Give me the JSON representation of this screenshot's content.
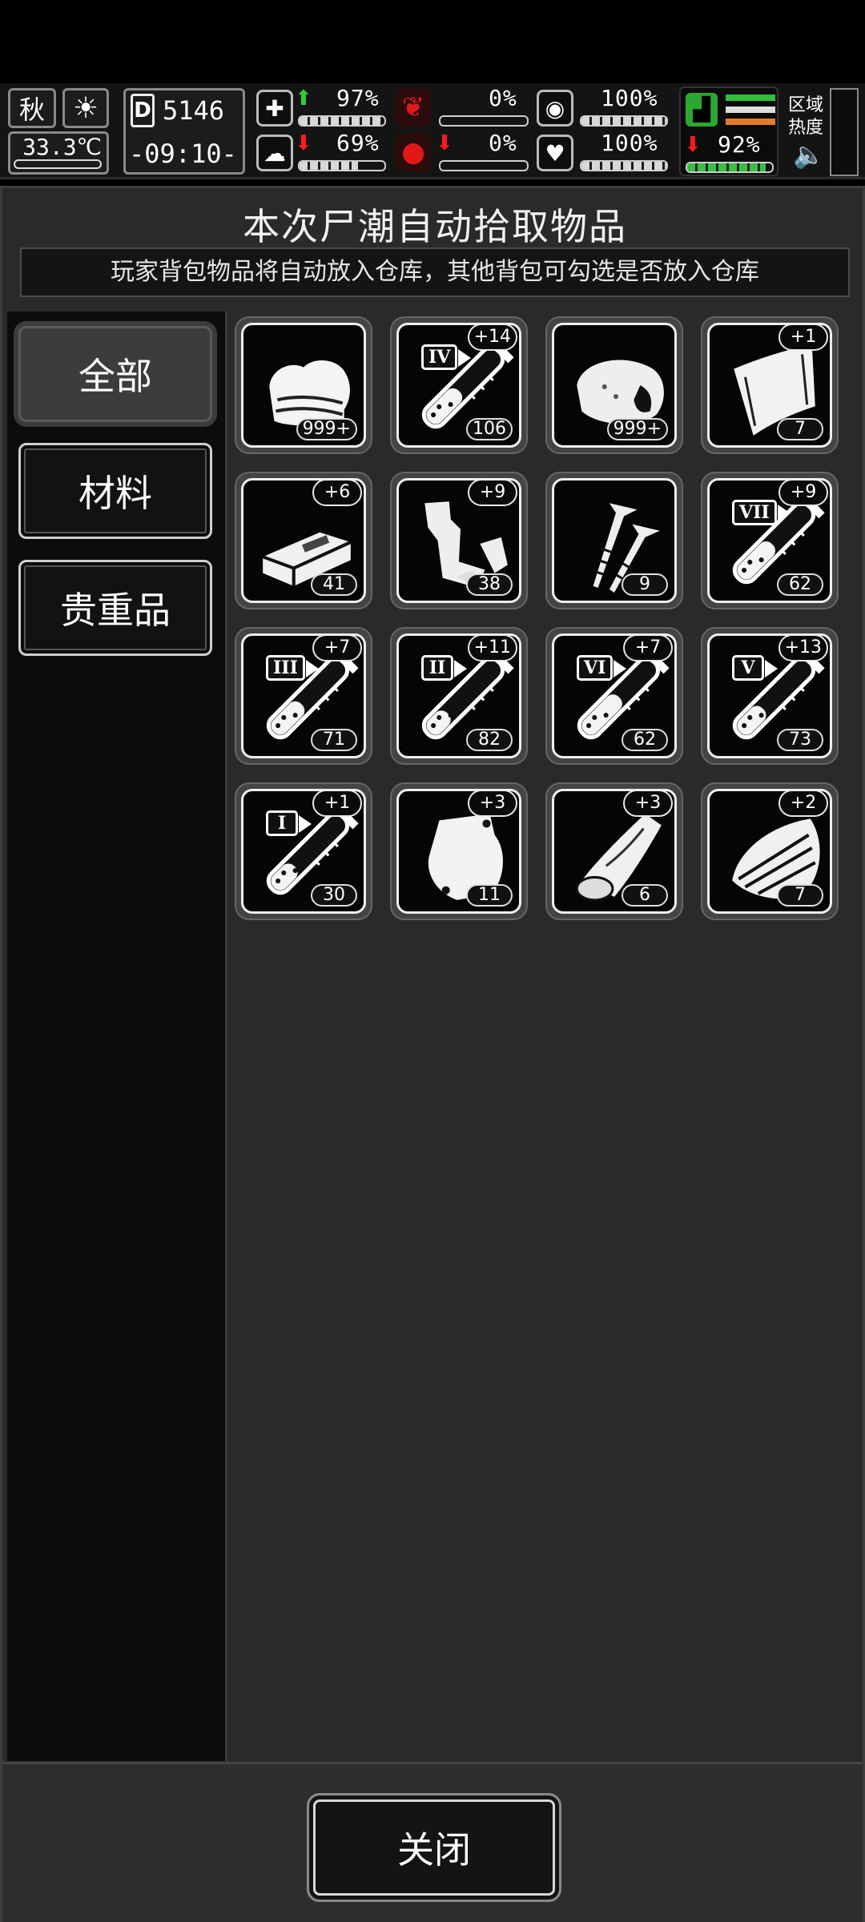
{
  "hud": {
    "season": "秋",
    "temperature": "33.3℃",
    "day": "5146",
    "time": "-09:10-",
    "health_pct": "97%",
    "health_level": 0.97,
    "brain_pct": "69%",
    "brain_level": 0.69,
    "stomach_pct": "0%",
    "stomach_level": 0,
    "blood_pct": "0%",
    "blood_level": 0,
    "pill_pct": "100%",
    "pill_level": 1.0,
    "heart_pct": "100%",
    "heart_level": 1.0,
    "stamina_pct": "92%",
    "stamina_level": 0.92,
    "zone_label": "区域热度"
  },
  "dialog": {
    "title": "本次尸潮自动拾取物品",
    "subtitle": "玩家背包物品将自动放入仓库，其他背包可勾选是否放入仓库"
  },
  "tabs": [
    {
      "label": "全部",
      "active": true
    },
    {
      "label": "材料",
      "active": false
    },
    {
      "label": "贵重品",
      "active": false
    }
  ],
  "items": [
    {
      "icon": "cloth-icon",
      "count": "999+",
      "bonus": ""
    },
    {
      "icon": "vial-icon",
      "roman": "IV",
      "count": "106",
      "bonus": "+14"
    },
    {
      "icon": "meat-icon",
      "count": "999+",
      "bonus": ""
    },
    {
      "icon": "leather-icon",
      "count": "7",
      "bonus": "+1"
    },
    {
      "icon": "brick-icon",
      "count": "41",
      "bonus": "+6"
    },
    {
      "icon": "scrap-metal-icon",
      "count": "38",
      "bonus": "+9"
    },
    {
      "icon": "screws-icon",
      "count": "9",
      "bonus": ""
    },
    {
      "icon": "vial-icon",
      "roman": "VII",
      "count": "62",
      "bonus": "+9"
    },
    {
      "icon": "vial-icon",
      "roman": "III",
      "count": "71",
      "bonus": "+7"
    },
    {
      "icon": "vial-icon",
      "roman": "II",
      "count": "82",
      "bonus": "+11"
    },
    {
      "icon": "vial-icon",
      "roman": "VI",
      "count": "62",
      "bonus": "+7"
    },
    {
      "icon": "vial-icon",
      "roman": "V",
      "count": "73",
      "bonus": "+13"
    },
    {
      "icon": "vial-icon",
      "roman": "I",
      "count": "30",
      "bonus": "+1"
    },
    {
      "icon": "bag-icon",
      "count": "11",
      "bonus": "+3"
    },
    {
      "icon": "log-icon",
      "count": "6",
      "bonus": "+3"
    },
    {
      "icon": "wood-pile-icon",
      "count": "7",
      "bonus": "+2"
    }
  ],
  "footer": {
    "close_label": "关闭"
  }
}
